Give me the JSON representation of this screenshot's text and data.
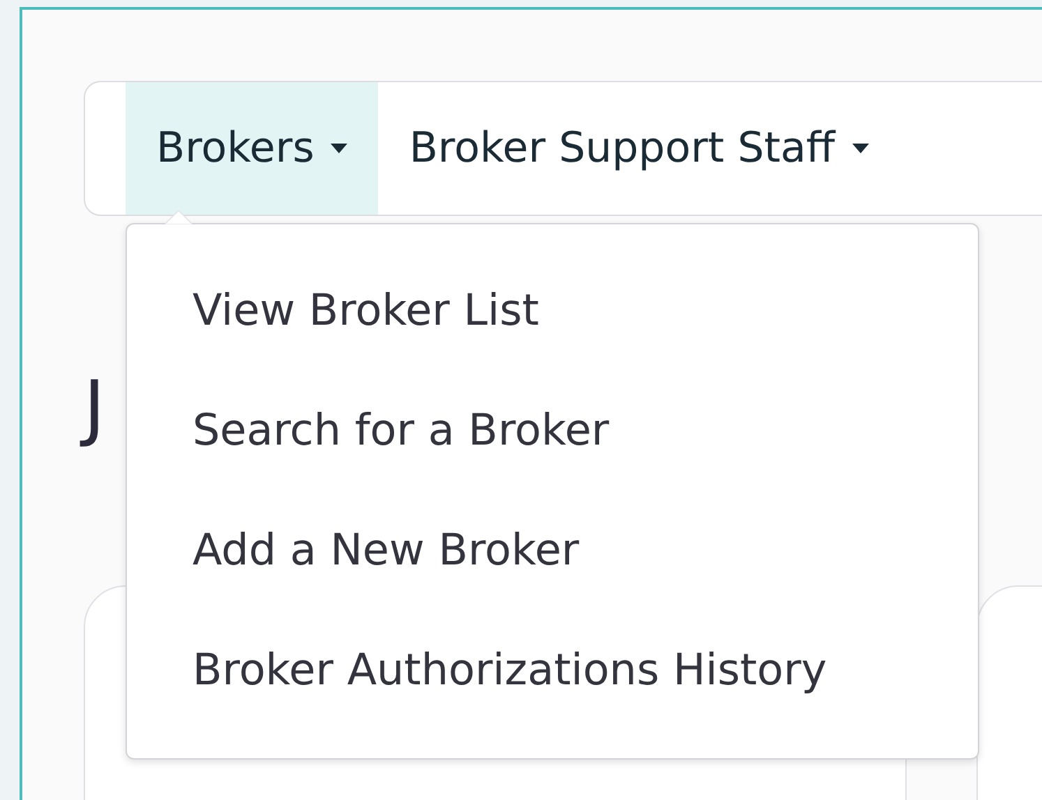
{
  "nav": {
    "tabs": [
      {
        "label": "Brokers",
        "selected": true
      },
      {
        "label": "Broker Support Staff",
        "selected": false
      }
    ]
  },
  "dropdown": {
    "open": true,
    "items": [
      {
        "label": "View Broker List"
      },
      {
        "label": "Search for a Broker"
      },
      {
        "label": "Add a New Broker"
      },
      {
        "label": "Broker Authorizations History"
      }
    ]
  },
  "heading": "J"
}
